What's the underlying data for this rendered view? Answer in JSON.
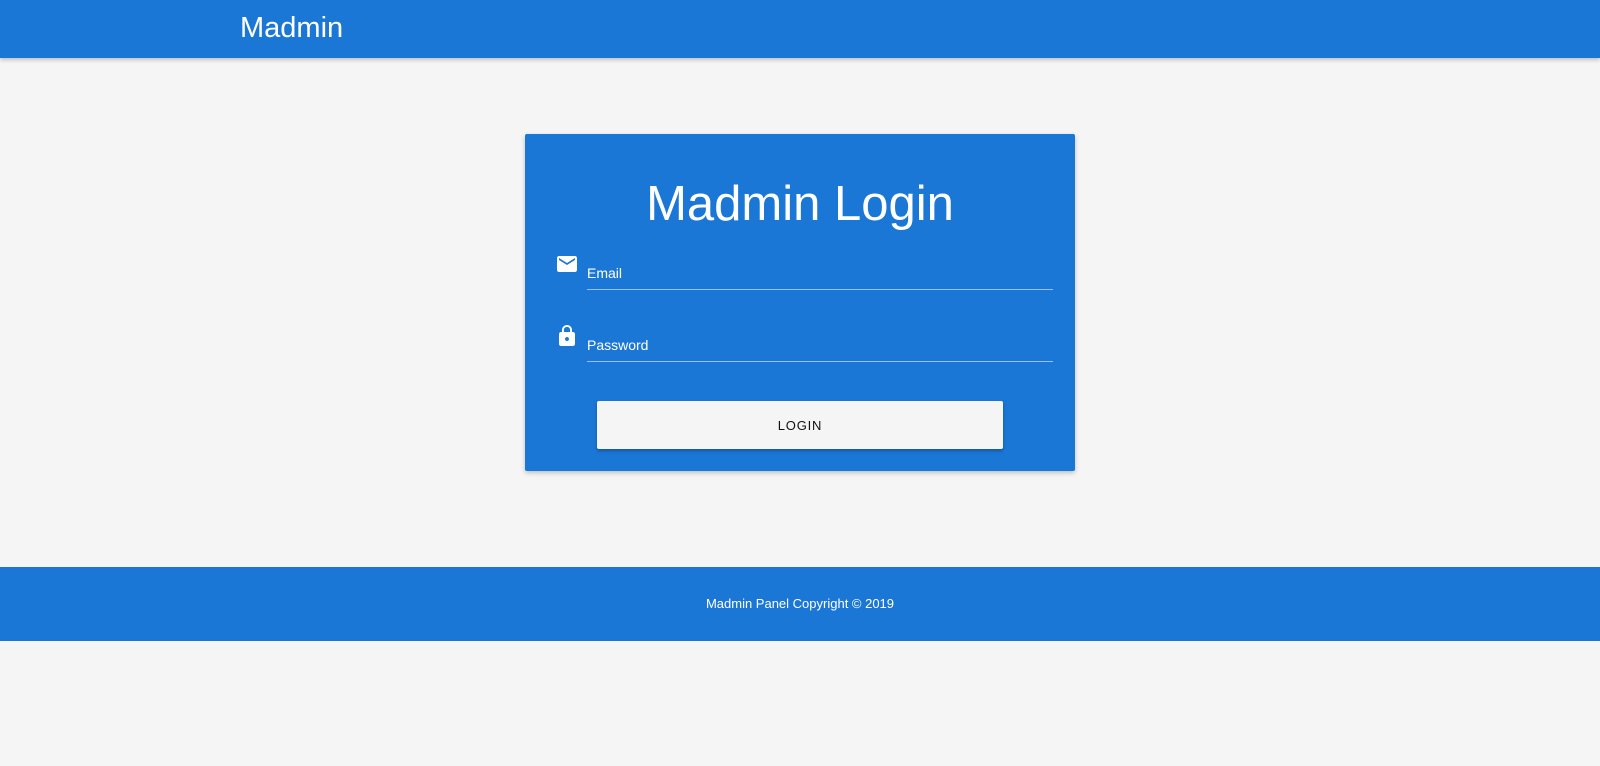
{
  "navbar": {
    "brand": "Madmin"
  },
  "login": {
    "title": "Madmin Login",
    "email": {
      "placeholder": "Email",
      "value": "",
      "icon": "email-icon"
    },
    "password": {
      "placeholder": "Password",
      "value": "",
      "icon": "lock-icon"
    },
    "button_label": "LOGIN"
  },
  "footer": {
    "text": "Madmin Panel Copyright © 2019"
  },
  "colors": {
    "primary": "#1b77d5",
    "background": "#f5f5f5",
    "text_on_primary": "#ffffff"
  }
}
